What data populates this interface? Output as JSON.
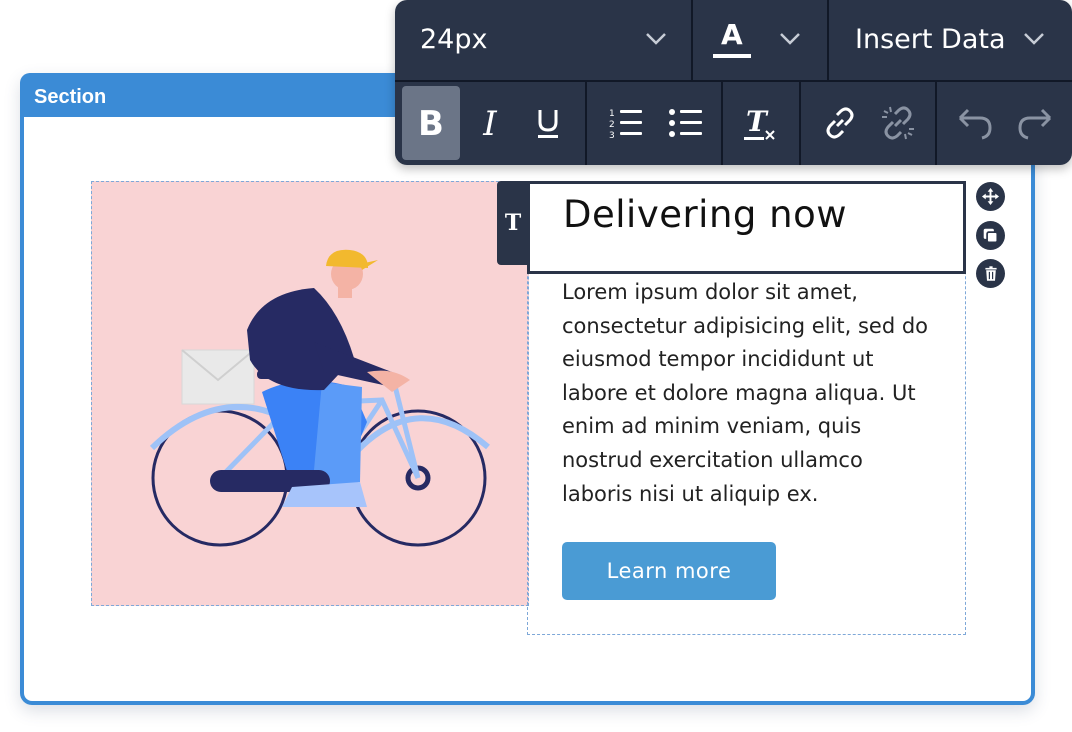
{
  "section": {
    "label": "Section"
  },
  "content": {
    "heading": "Delivering now",
    "body": "Lorem ipsum dolor sit amet,\nconsectetur adipisicing elit, sed do\neiusmod tempor incididunt ut\nlabore et dolore magna aliqua. Ut\nenim ad minim veniam, quis\nnostrud exercitation ullamco\nlaboris nisi ut aliquip ex.",
    "button_label": "Learn more",
    "text_block_tab": "T"
  },
  "toolbar": {
    "font_size": "24px",
    "text_color_glyph": "A",
    "insert_data_label": "Insert Data",
    "format_buttons": [
      "bold-icon",
      "italic-icon",
      "underline-icon",
      "ordered-list-icon",
      "unordered-list-icon",
      "clear-format-icon",
      "link-icon",
      "unlink-icon",
      "undo-icon",
      "redo-icon"
    ],
    "active_button": "bold-icon"
  },
  "side_controls": [
    "move-icon",
    "duplicate-icon",
    "delete-icon"
  ],
  "colors": {
    "section_accent": "#3b8bd6",
    "toolbar_bg": "#2a3448",
    "image_bg": "#f9d3d4",
    "button_bg": "#4a9bd4"
  }
}
